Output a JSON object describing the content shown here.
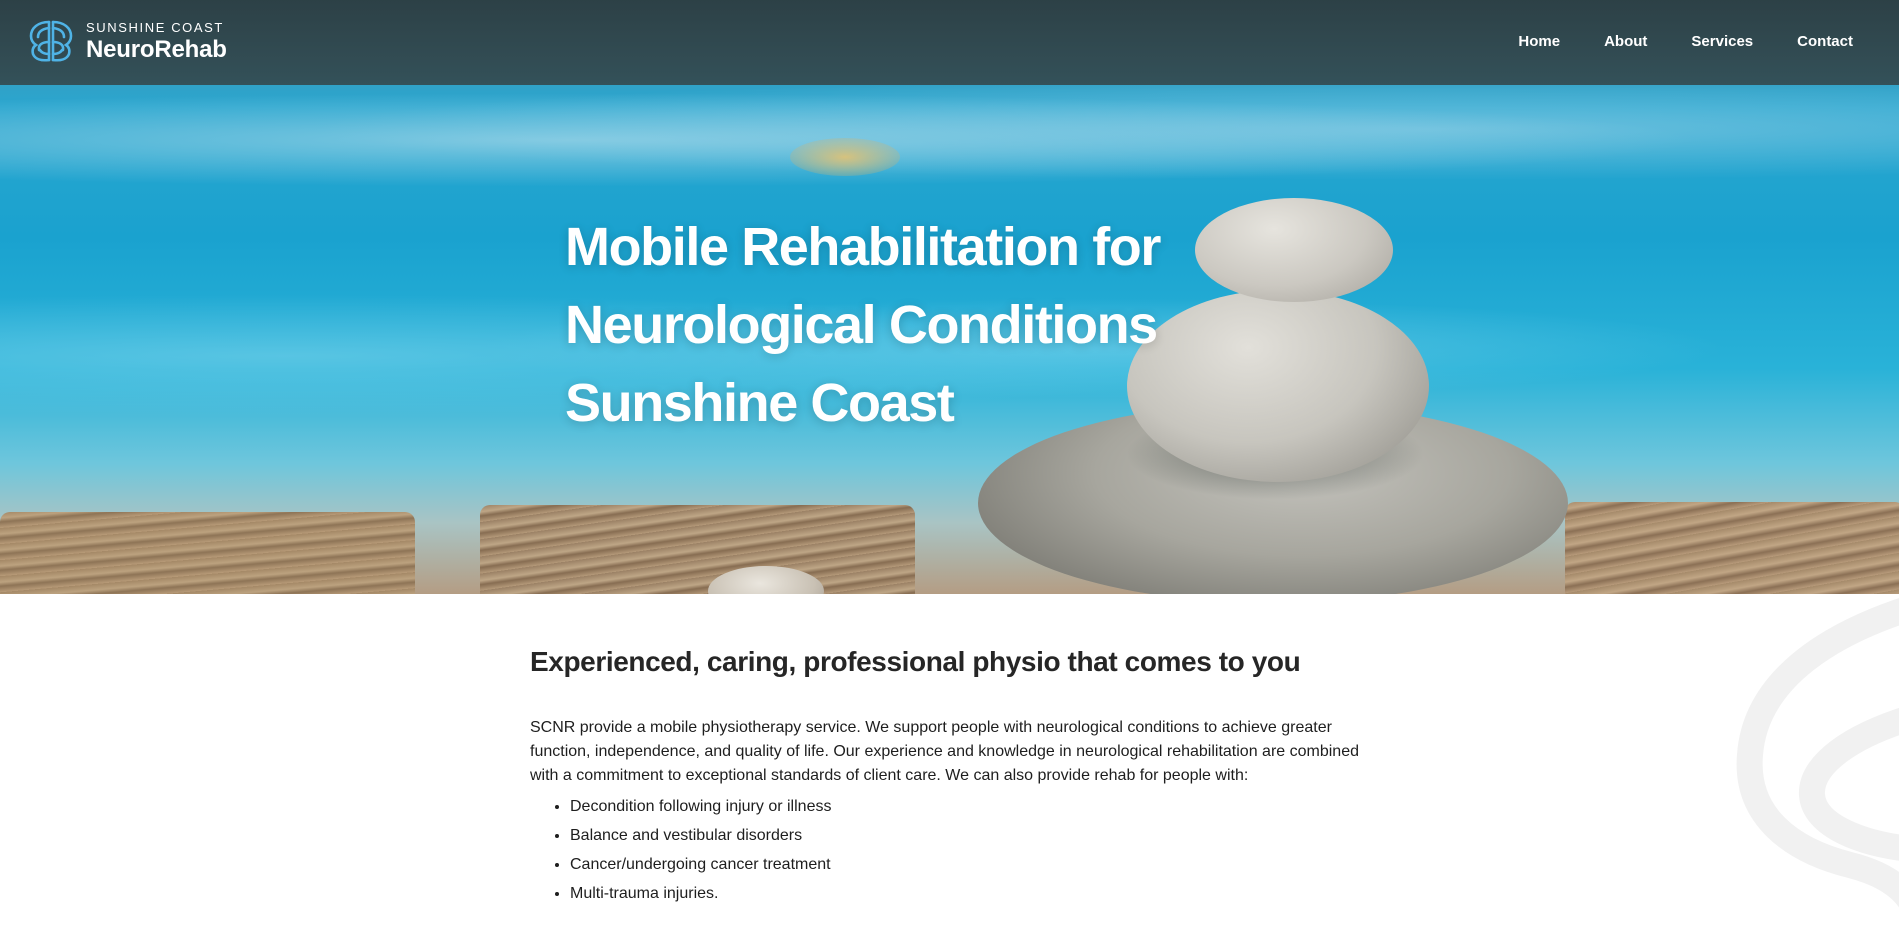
{
  "header": {
    "logo": {
      "small_text": "SUNSHINE COAST",
      "big_text": "NeuroRehab",
      "icon": "brain-logo-icon",
      "accent_color": "#4fb3e6"
    },
    "nav": {
      "items": [
        {
          "label": "Home"
        },
        {
          "label": "About"
        },
        {
          "label": "Services"
        },
        {
          "label": "Contact"
        }
      ]
    }
  },
  "hero": {
    "title_lines": [
      "Mobile Rehabilitation for",
      "Neurological Conditions",
      "Sunshine Coast"
    ]
  },
  "main": {
    "heading": "Experienced, caring, professional physio that comes to you",
    "intro": "SCNR provide a mobile physiotherapy service. We support people with neurological conditions to achieve greater function, independence, and quality of life. Our experience and knowledge in neurological rehabilitation are combined with a commitment to exceptional standards of client care. We can also provide rehab for people with:",
    "list": [
      "Decondition following injury or illness",
      "Balance and vestibular disorders",
      "Cancer/undergoing cancer treatment",
      "Multi-trauma injuries."
    ]
  }
}
